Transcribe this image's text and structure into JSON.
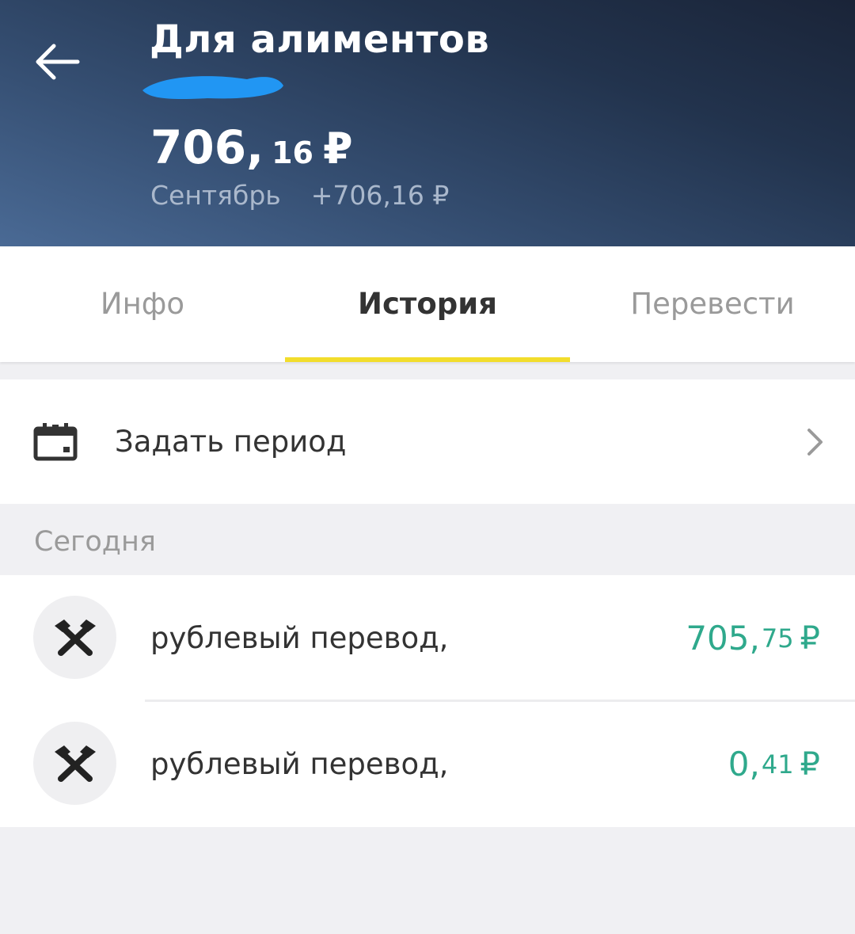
{
  "header": {
    "title": "Для алиментов",
    "balance_int": "706,",
    "balance_frac": "16",
    "balance_currency": "₽",
    "month": "Сентябрь",
    "month_delta": "+706,16 ₽"
  },
  "tabs": [
    {
      "label": "Инфо",
      "active": false
    },
    {
      "label": "История",
      "active": true
    },
    {
      "label": "Перевести",
      "active": false
    }
  ],
  "period": {
    "label": "Задать период"
  },
  "section": {
    "label": "Сегодня"
  },
  "transactions": [
    {
      "title": "рублевый перевод,",
      "amount_int": "705,",
      "amount_frac": "75",
      "currency": "₽"
    },
    {
      "title": "рублевый перевод,",
      "amount_int": "0,",
      "amount_frac": "41",
      "currency": "₽"
    }
  ],
  "colors": {
    "accent_tab": "#f2dd2c",
    "income": "#2fa98c",
    "redaction": "#2196f3"
  },
  "icons": {
    "back": "arrow-left-icon",
    "calendar": "calendar-icon",
    "chevron": "chevron-right-icon",
    "bank": "crossed-hammers-icon"
  }
}
